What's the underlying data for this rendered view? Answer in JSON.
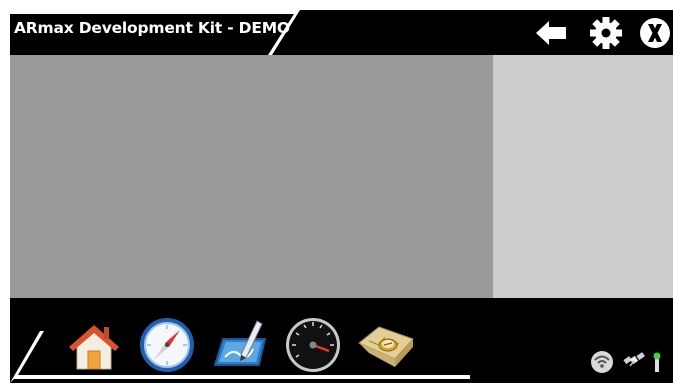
{
  "header": {
    "title": "ARmax Development Kit - DEMO",
    "buttons": [
      {
        "name": "back",
        "icon": "back-arrow-icon"
      },
      {
        "name": "settings",
        "icon": "gear-icon"
      },
      {
        "name": "close",
        "icon": "close-icon"
      }
    ]
  },
  "dock": {
    "items": [
      {
        "name": "home",
        "icon": "home-icon"
      },
      {
        "name": "compass",
        "icon": "compass-icon"
      },
      {
        "name": "draw",
        "icon": "drawing-tablet-icon"
      },
      {
        "name": "speedometer",
        "icon": "speedometer-icon"
      },
      {
        "name": "map",
        "icon": "map-compass-icon"
      }
    ]
  },
  "status": {
    "items": [
      {
        "name": "wifi",
        "icon": "wifi-icon"
      },
      {
        "name": "satellite",
        "icon": "satellite-icon"
      },
      {
        "name": "signal",
        "icon": "signal-antenna-icon"
      }
    ]
  },
  "colors": {
    "bar": "#000000",
    "main_pane": "#999999",
    "side_pane": "#cccccc",
    "accent_blue": "#2a7fd4"
  }
}
